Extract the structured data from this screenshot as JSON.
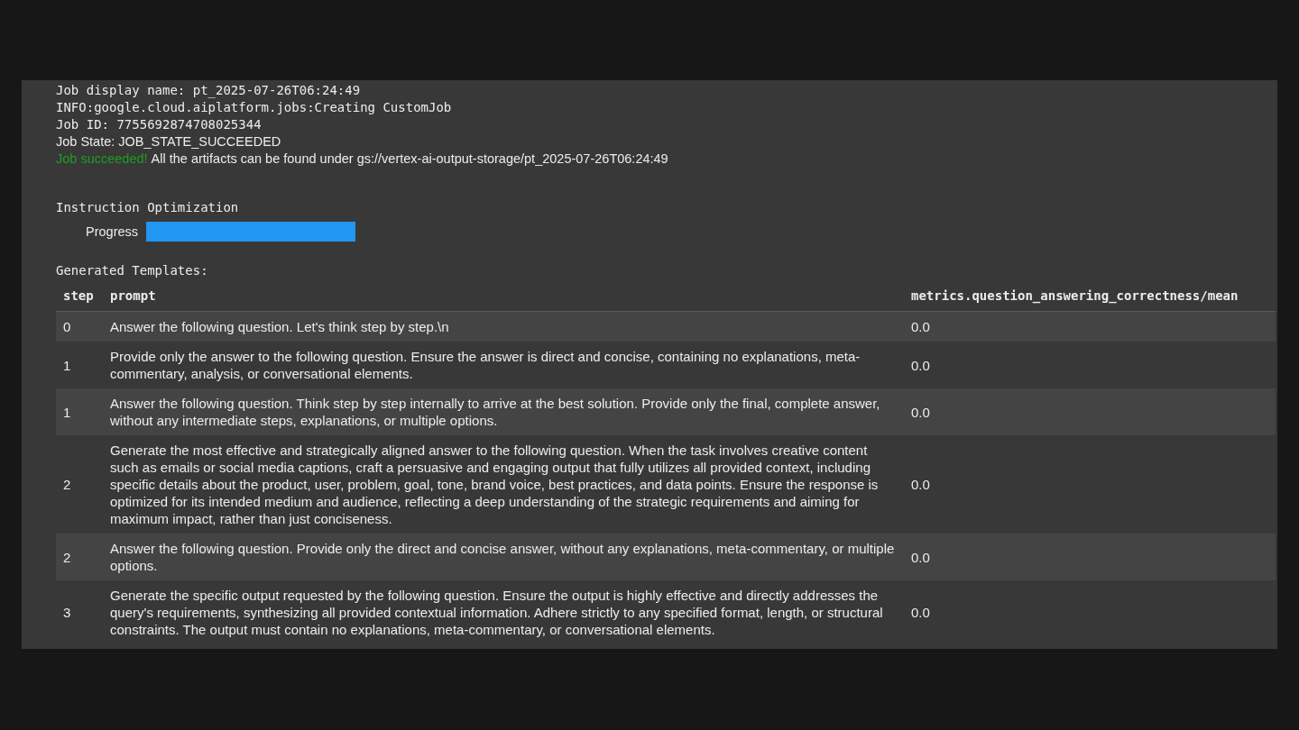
{
  "log_lines": [
    {
      "kind": "mono",
      "text": "Job display name: pt_2025-07-26T06:24:49"
    },
    {
      "kind": "mono",
      "text": "INFO:google.cloud.aiplatform.jobs:Creating CustomJob"
    },
    {
      "kind": "mono",
      "text": "Job ID: 7755692874708025344"
    },
    {
      "kind": "sans",
      "text": "Job State: JOB_STATE_SUCCEEDED"
    },
    {
      "kind": "status",
      "badge": "Job succeeded!",
      "text": "All the artifacts can be found under gs://vertex-ai-output-storage/pt_2025-07-26T06:24:49"
    }
  ],
  "optimization": {
    "title": "Instruction Optimization",
    "progress_label": "Progress",
    "level": 1
  },
  "templates": {
    "title": "Generated Templates:",
    "columns": [
      "step",
      "prompt",
      "metrics.question_answering_correctness/mean"
    ],
    "rows": [
      {
        "step": "0",
        "prompt": "Answer the following question. Let's think step by step.\\n",
        "metric": "0.0"
      },
      {
        "step": "1",
        "prompt": "Provide only the answer to the following question. Ensure the answer is direct and concise, containing no explanations, meta-commentary, analysis, or conversational elements.",
        "metric": "0.0"
      },
      {
        "step": "1",
        "prompt": "Answer the following question. Think step by step internally to arrive at the best solution. Provide only the final, complete answer, without any intermediate steps, explanations, or multiple options.",
        "metric": "0.0"
      },
      {
        "step": "2",
        "prompt": "Generate the most effective and strategically aligned answer to the following question. When the task involves creative content such as emails or social media captions, craft a persuasive and engaging output that fully utilizes all provided context, including specific details about the product, user, problem, goal, tone, brand voice, best practices, and data points. Ensure the response is optimized for its intended medium and audience, reflecting a deep understanding of the strategic requirements and aiming for maximum impact, rather than just conciseness.",
        "metric": "0.0"
      },
      {
        "step": "2",
        "prompt": "Answer the following question. Provide only the direct and concise answer, without any explanations, meta-commentary, or multiple options.",
        "metric": "0.0"
      },
      {
        "step": "3",
        "prompt": "Generate the specific output requested by the following question. Ensure the output is highly effective and directly addresses the query's requirements, synthesizing all provided contextual information. Adhere strictly to any specified format, length, or structural constraints. The output must contain no explanations, meta-commentary, or conversational elements.",
        "metric": "0.0"
      }
    ]
  }
}
